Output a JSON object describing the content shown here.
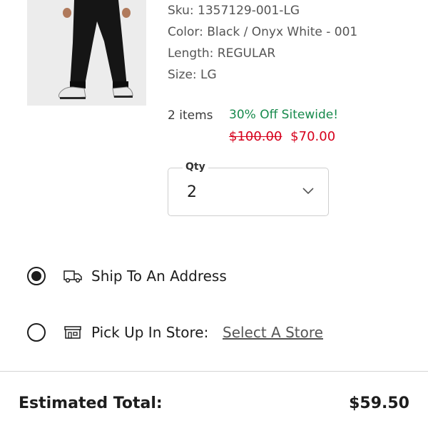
{
  "product": {
    "image_alt": "product-photo-black-joggers",
    "sku": "Sku: 1357129-001-LG",
    "color": "Color: Black / Onyx White - 001",
    "length": "Length: REGULAR",
    "size": "Size: LG"
  },
  "pricing": {
    "item_count": "2 items",
    "promo": "30% Off Sitewide!",
    "original_price": "$100.00",
    "sale_price": "$70.00",
    "promo_color": "#178a4c",
    "price_color": "#d6001c"
  },
  "quantity": {
    "label": "Qty",
    "value": "2",
    "icon": "chevron-down-icon"
  },
  "fulfillment": {
    "ship": {
      "label": "Ship To An Address",
      "selected": true,
      "icon": "truck-icon"
    },
    "pickup": {
      "label": "Pick Up In Store:",
      "selected": false,
      "icon": "store-icon",
      "link": "Select A Store"
    }
  },
  "summary": {
    "total_label": "Estimated Total:",
    "total_value": "$59.50"
  }
}
